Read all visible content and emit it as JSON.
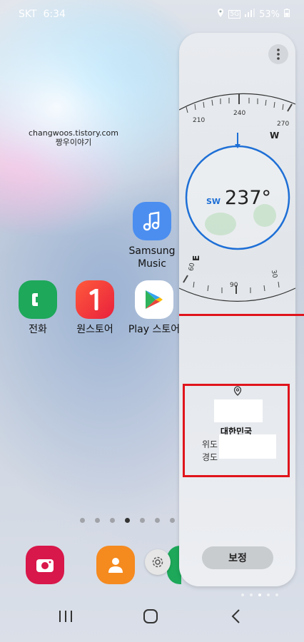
{
  "status": {
    "carrier": "SKT",
    "time": "6:34",
    "battery": "53%"
  },
  "watermark": {
    "line1": "changwoos.tistory.com",
    "line2": "짱우이야기"
  },
  "apps": {
    "samsung_music": "Samsung\nMusic",
    "phone": "전화",
    "onestore": "원스토어",
    "playstore": "Play 스토어"
  },
  "compass": {
    "direction": "SW",
    "heading": "237°",
    "ticks_top": [
      "210",
      "240",
      "270"
    ],
    "ticks_bottom": [
      "60",
      "90",
      "30"
    ],
    "cardinal_w": "W",
    "cardinal_e": "E",
    "accent": "#1e6fd6"
  },
  "location": {
    "country": "대한민국",
    "lat_label": "위도",
    "lon_label": "경도"
  },
  "calibrate_label": "보정"
}
